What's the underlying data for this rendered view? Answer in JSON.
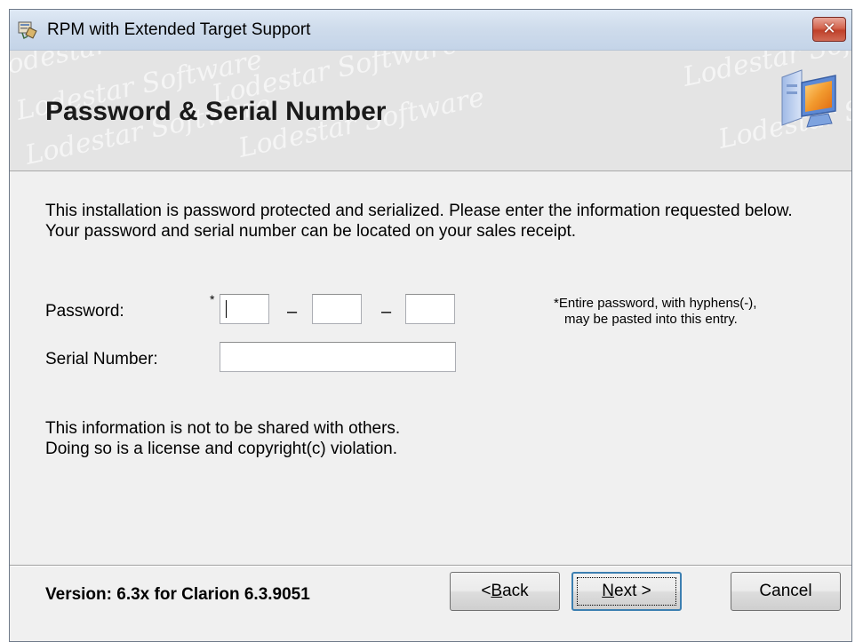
{
  "window": {
    "title": "RPM with Extended Target Support",
    "close_glyph": "✕"
  },
  "banner": {
    "title": "Password & Serial Number",
    "watermark_text": "Lodestar Software",
    "icon": "computer-setup-icon"
  },
  "body": {
    "intro": "This installation is password protected and serialized. Please enter the information requested below. Your password and serial number can be located on your sales receipt.",
    "password_label": "Password:",
    "password_required_marker": "*",
    "password_separator": "–",
    "password_segments": [
      "",
      "",
      ""
    ],
    "serial_label": "Serial Number:",
    "serial_value": "",
    "note_marker": "*",
    "note_line1": "Entire password, with hyphens(-),",
    "note_line2": "may be pasted into this entry.",
    "warning_line1": "This information is not to be shared with others.",
    "warning_line2": "Doing so is a license and copyright(c) violation."
  },
  "footer": {
    "version": "Version: 6.3x for Clarion 6.3.9051",
    "back_prefix": "< ",
    "back_mnemonic": "B",
    "back_rest": "ack",
    "next_mnemonic": "N",
    "next_rest": "ext >",
    "cancel_label": "Cancel"
  },
  "colors": {
    "titlebar": "#c4d4e8",
    "banner": "#e4e4e4",
    "dialog": "#f0f0f0",
    "close_button": "#c0412a",
    "default_button_border": "#3c7fb1"
  }
}
